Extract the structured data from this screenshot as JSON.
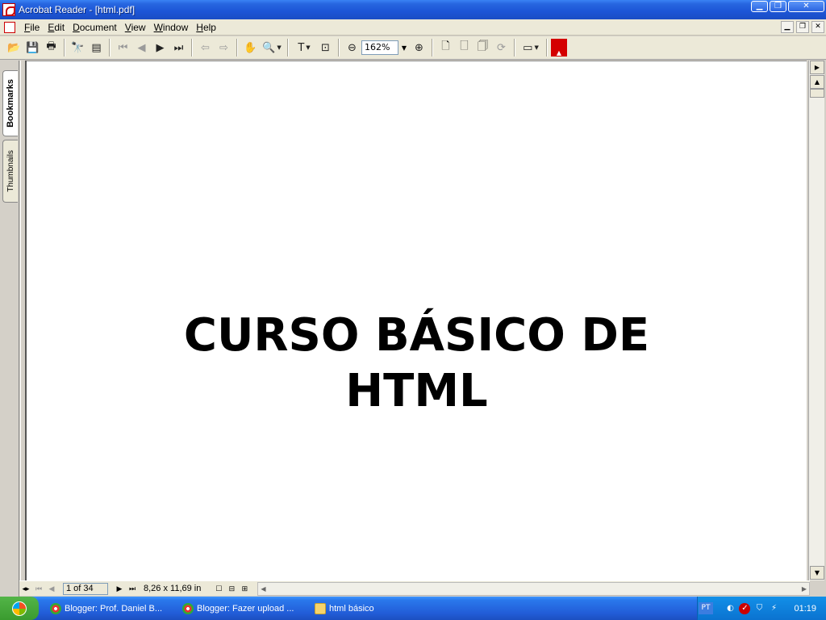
{
  "window": {
    "title": "Acrobat Reader - [html.pdf]"
  },
  "menu": [
    "File",
    "Edit",
    "Document",
    "View",
    "Window",
    "Help"
  ],
  "toolbar": {
    "zoom": "162%"
  },
  "nav_tabs": {
    "bookmarks": "Bookmarks",
    "thumbnails": "Thumbnails"
  },
  "document": {
    "title_line1": "CURSO BÁSICO DE",
    "title_line2": "HTML"
  },
  "status": {
    "page": "1 of 34",
    "page_size": "8,26 x 11,69 in"
  },
  "taskbar": {
    "tasks": [
      "Blogger: Prof. Daniel B...",
      "Blogger: Fazer upload ...",
      "html básico"
    ],
    "language": "PT",
    "clock": "01:19"
  }
}
